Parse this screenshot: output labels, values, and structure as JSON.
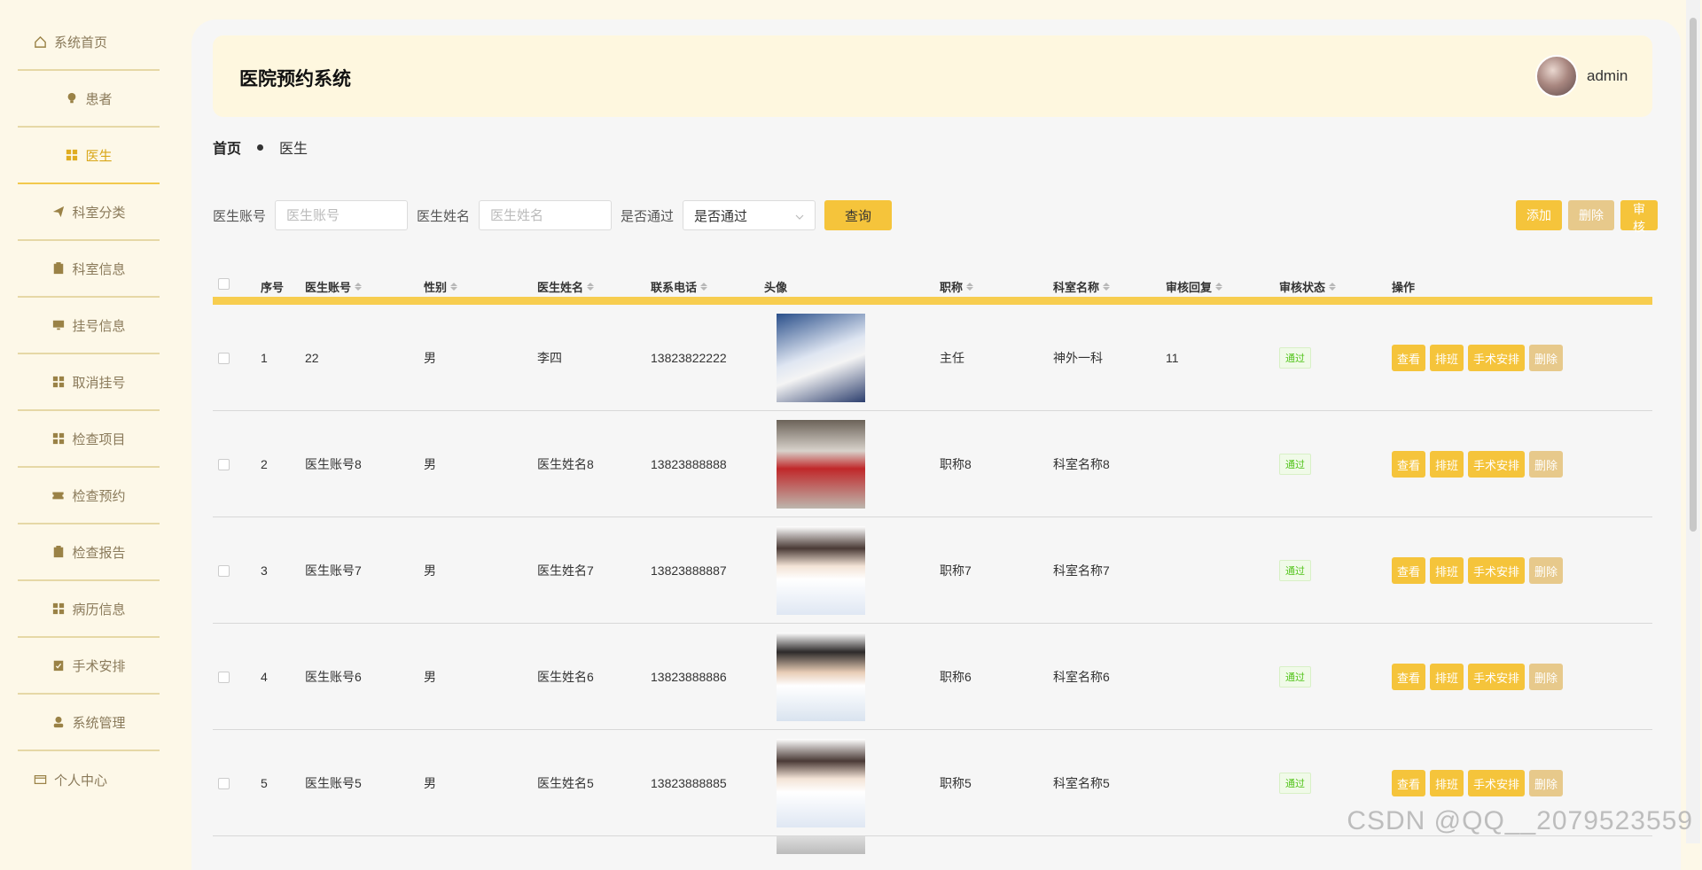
{
  "sidebar": {
    "items": [
      {
        "label": "系统首页",
        "icon": "home-icon"
      },
      {
        "label": "患者",
        "icon": "bulb-icon"
      },
      {
        "label": "医生",
        "icon": "grid-icon"
      },
      {
        "label": "科室分类",
        "icon": "paper-plane-icon"
      },
      {
        "label": "科室信息",
        "icon": "clipboard-icon"
      },
      {
        "label": "挂号信息",
        "icon": "monitor-icon"
      },
      {
        "label": "取消挂号",
        "icon": "grid-icon"
      },
      {
        "label": "检查项目",
        "icon": "grid-icon"
      },
      {
        "label": "检查预约",
        "icon": "ticket-icon"
      },
      {
        "label": "检查报告",
        "icon": "clipboard-icon"
      },
      {
        "label": "病历信息",
        "icon": "grid-icon"
      },
      {
        "label": "手术安排",
        "icon": "clipboard-check-icon"
      },
      {
        "label": "系统管理",
        "icon": "user-icon"
      },
      {
        "label": "个人中心",
        "icon": "card-icon"
      }
    ],
    "active_index": 2
  },
  "header": {
    "title": "医院预约系统",
    "username": "admin"
  },
  "breadcrumb": {
    "home": "首页",
    "current": "医生"
  },
  "search": {
    "account_label": "医生账号",
    "account_placeholder": "医生账号",
    "name_label": "医生姓名",
    "name_placeholder": "医生姓名",
    "pass_label": "是否通过",
    "pass_placeholder": "是否通过",
    "query_button": "查询"
  },
  "toolbar": {
    "add": "添加",
    "delete": "删除",
    "audit": "审核"
  },
  "table": {
    "columns": [
      "序号",
      "医生账号",
      "性别",
      "医生姓名",
      "联系电话",
      "头像",
      "职称",
      "科室名称",
      "审核回复",
      "审核状态",
      "操作"
    ],
    "rows": [
      {
        "no": "1",
        "account": "22",
        "gender": "男",
        "name": "李四",
        "phone": "13823822222",
        "title": "主任",
        "dept": "神外一科",
        "reply": "11",
        "status": "通过"
      },
      {
        "no": "2",
        "account": "医生账号8",
        "gender": "男",
        "name": "医生姓名8",
        "phone": "13823888888",
        "title": "职称8",
        "dept": "科室名称8",
        "reply": "",
        "status": "通过"
      },
      {
        "no": "3",
        "account": "医生账号7",
        "gender": "男",
        "name": "医生姓名7",
        "phone": "13823888887",
        "title": "职称7",
        "dept": "科室名称7",
        "reply": "",
        "status": "通过"
      },
      {
        "no": "4",
        "account": "医生账号6",
        "gender": "男",
        "name": "医生姓名6",
        "phone": "13823888886",
        "title": "职称6",
        "dept": "科室名称6",
        "reply": "",
        "status": "通过"
      },
      {
        "no": "5",
        "account": "医生账号5",
        "gender": "男",
        "name": "医生姓名5",
        "phone": "13823888885",
        "title": "职称5",
        "dept": "科室名称5",
        "reply": "",
        "status": "通过"
      }
    ],
    "row_actions": {
      "view": "查看",
      "schedule": "排班",
      "surgery": "手术安排",
      "delete": "删除"
    }
  },
  "watermark": "CSDN @QQ__2079523559",
  "colors": {
    "accent": "#f5c43b",
    "accent_muted": "#e7c98b",
    "sidebar_bg": "#fdf8e8",
    "header_bg": "#fef7df",
    "success": "#52c41a"
  }
}
